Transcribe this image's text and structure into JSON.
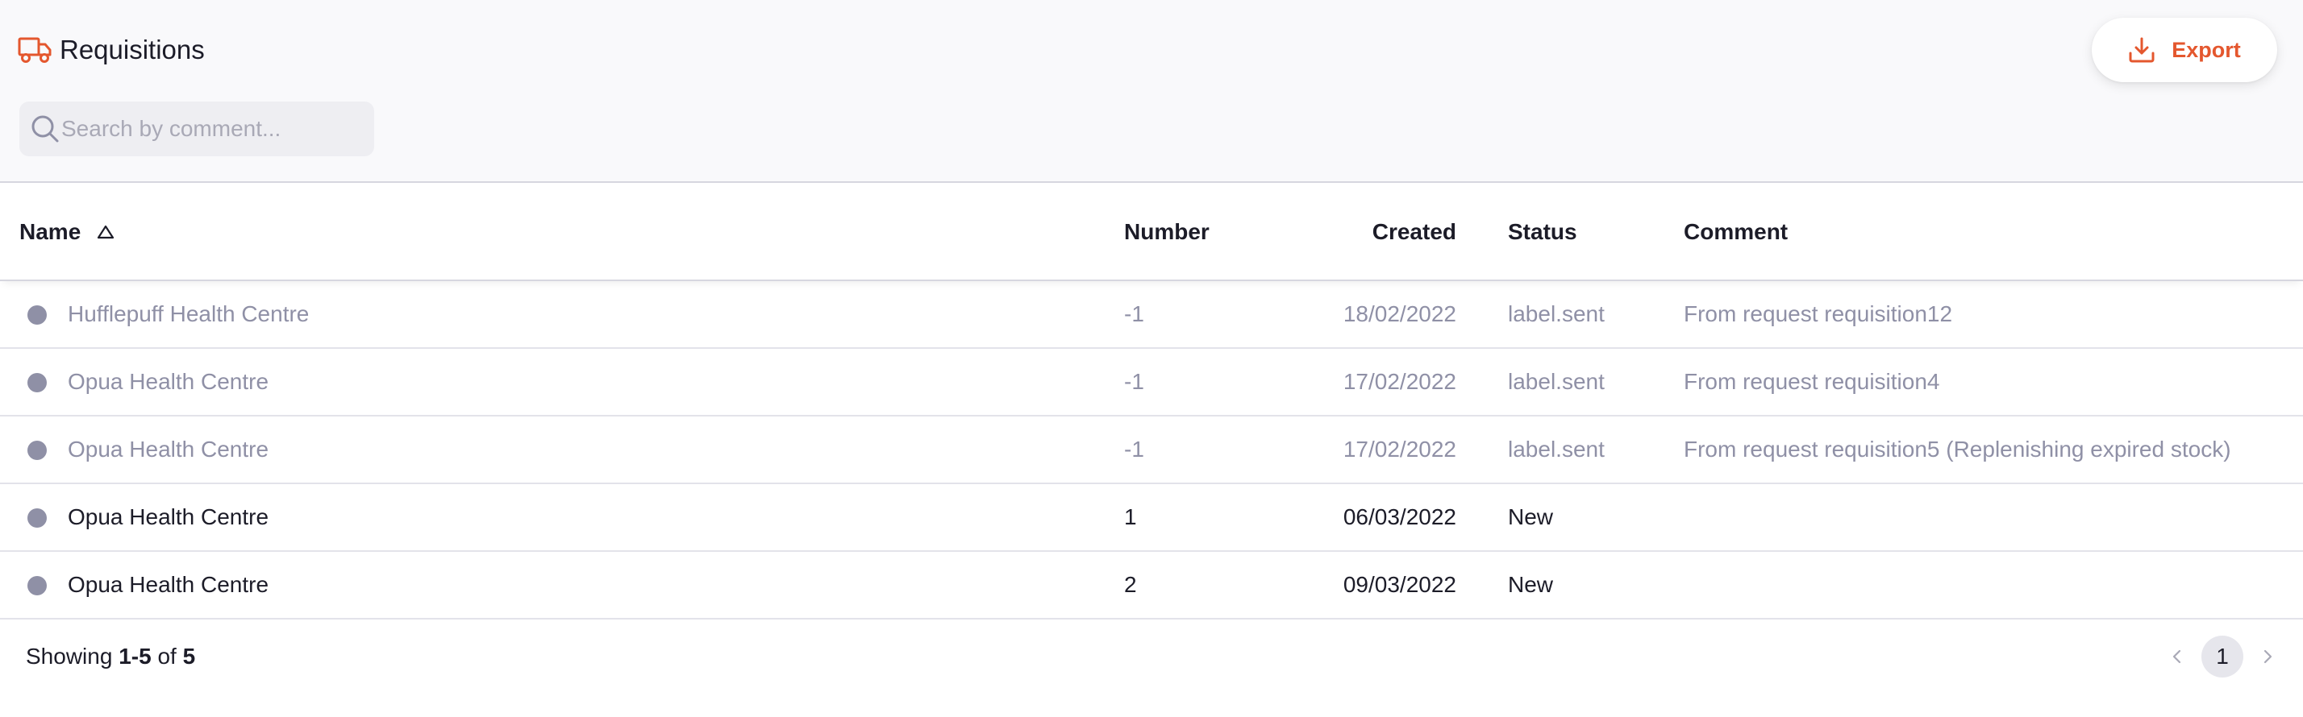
{
  "header": {
    "title": "Requisitions",
    "title_icon": "truck-icon",
    "accent_color": "#e4572e"
  },
  "search": {
    "placeholder": "Search by comment...",
    "value": ""
  },
  "toolbar": {
    "export_label": "Export",
    "export_icon": "download-icon"
  },
  "table": {
    "columns": {
      "name": "Name",
      "number": "Number",
      "created": "Created",
      "status": "Status",
      "comment": "Comment"
    },
    "sort": {
      "column": "Name",
      "direction": "ascending"
    },
    "rows": [
      {
        "name": "Hufflepuff Health Centre",
        "number": "-1",
        "created": "18/02/2022",
        "status": "label.sent",
        "comment": "From request requisition12",
        "muted": true
      },
      {
        "name": "Opua Health Centre",
        "number": "-1",
        "created": "17/02/2022",
        "status": "label.sent",
        "comment": "From request requisition4",
        "muted": true
      },
      {
        "name": "Opua Health Centre",
        "number": "-1",
        "created": "17/02/2022",
        "status": "label.sent",
        "comment": "From request requisition5 (Replenishing expired stock)",
        "muted": true
      },
      {
        "name": "Opua Health Centre",
        "number": "1",
        "created": "06/03/2022",
        "status": "New",
        "comment": "",
        "muted": false
      },
      {
        "name": "Opua Health Centre",
        "number": "2",
        "created": "09/03/2022",
        "status": "New",
        "comment": "",
        "muted": false
      }
    ]
  },
  "footer": {
    "showing_prefix": "Showing",
    "range": "1-5",
    "of_label": "of",
    "total": "5",
    "current_page": "1"
  }
}
